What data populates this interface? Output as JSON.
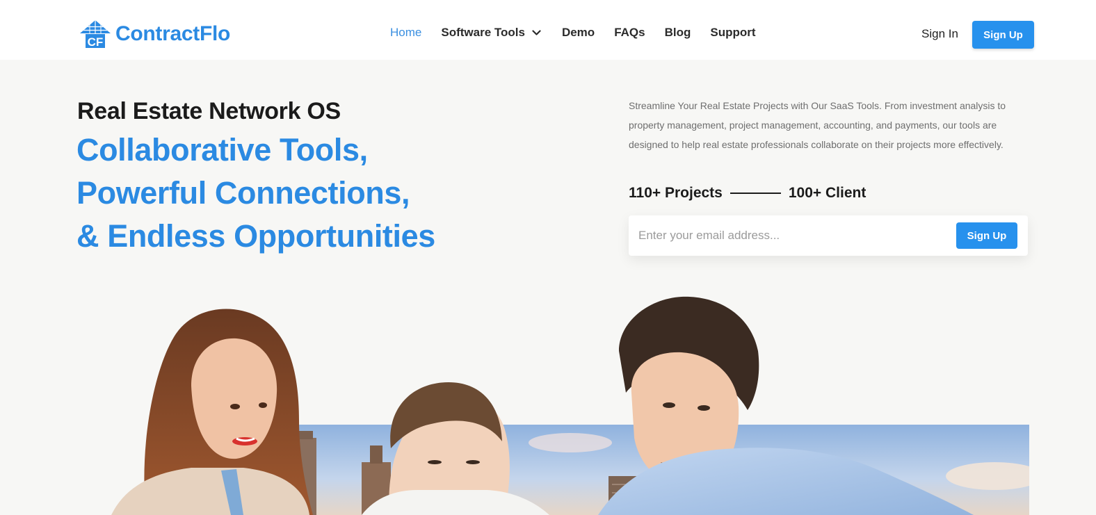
{
  "brand": {
    "name": "ContractFlo",
    "mark_letters": "CF",
    "color": "#2b8ae2"
  },
  "nav": {
    "items": [
      {
        "label": "Home",
        "active": true
      },
      {
        "label": "Software Tools",
        "has_dropdown": true
      },
      {
        "label": "Demo"
      },
      {
        "label": "FAQs"
      },
      {
        "label": "Blog"
      },
      {
        "label": "Support"
      }
    ],
    "sign_in": "Sign In",
    "sign_up": "Sign Up"
  },
  "hero": {
    "eyebrow": "Real Estate Network OS",
    "headline": [
      "Collaborative Tools,",
      "Powerful Connections,",
      "& Endless Opportunities"
    ],
    "description": "Streamline Your Real Estate Projects with Our SaaS Tools. From investment analysis to property management, project management, accounting, and payments, our tools are designed to help real estate professionals collaborate on their projects more effectively.",
    "stats": [
      "110+ Projects",
      "100+ Client"
    ],
    "email_placeholder": "Enter your email address...",
    "email_button": "Sign Up"
  },
  "colors": {
    "accent": "#2791ed",
    "heading_blue": "#2b8ae2",
    "background": "#f7f7f5"
  }
}
